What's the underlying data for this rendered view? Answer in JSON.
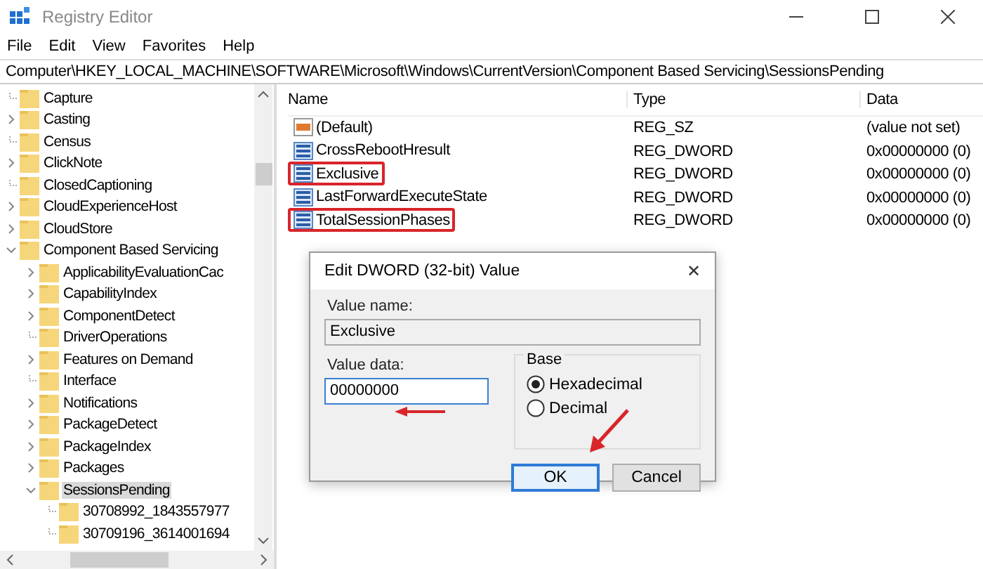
{
  "window": {
    "title": "Registry Editor"
  },
  "menu": [
    "File",
    "Edit",
    "View",
    "Favorites",
    "Help"
  ],
  "address": "Computer\\HKEY_LOCAL_MACHINE\\SOFTWARE\\Microsoft\\Windows\\CurrentVersion\\Component Based Servicing\\SessionsPending",
  "tree": [
    {
      "label": "Capture",
      "selected": false
    },
    {
      "label": "Casting",
      "expanded": false,
      "selected": false
    },
    {
      "label": "Census",
      "selected": false
    },
    {
      "label": "ClickNote",
      "expanded": false,
      "selected": false
    },
    {
      "label": "ClosedCaptioning",
      "selected": false
    },
    {
      "label": "CloudExperienceHost",
      "expanded": false,
      "selected": false
    },
    {
      "label": "CloudStore",
      "expanded": false,
      "selected": false
    },
    {
      "label": "Component Based Servicing",
      "expanded": true,
      "selected": false,
      "children": [
        {
          "label": "ApplicabilityEvaluationCac",
          "expanded": false,
          "selected": false
        },
        {
          "label": "CapabilityIndex",
          "expanded": false,
          "selected": false
        },
        {
          "label": "ComponentDetect",
          "expanded": false,
          "selected": false
        },
        {
          "label": "DriverOperations",
          "selected": false
        },
        {
          "label": "Features on Demand",
          "expanded": false,
          "selected": false
        },
        {
          "label": "Interface",
          "selected": false
        },
        {
          "label": "Notifications",
          "expanded": false,
          "selected": false
        },
        {
          "label": "PackageDetect",
          "expanded": false,
          "selected": false
        },
        {
          "label": "PackageIndex",
          "expanded": false,
          "selected": false
        },
        {
          "label": "Packages",
          "expanded": false,
          "selected": false
        },
        {
          "label": "SessionsPending",
          "expanded": true,
          "selected": true,
          "children": [
            {
              "label": "30708992_1843557977",
              "selected": false
            },
            {
              "label": "30709196_3614001694",
              "selected": false
            }
          ]
        }
      ]
    }
  ],
  "table": {
    "columns": [
      "Name",
      "Type",
      "Data"
    ],
    "rows": [
      {
        "kind": "string",
        "name": "(Default)",
        "type": "REG_SZ",
        "data": "(value not set)",
        "highlighted": false
      },
      {
        "kind": "dword",
        "name": "CrossRebootHresult",
        "type": "REG_DWORD",
        "data": "0x00000000 (0)",
        "highlighted": false
      },
      {
        "kind": "dword",
        "name": "Exclusive",
        "type": "REG_DWORD",
        "data": "0x00000000 (0)",
        "highlighted": true
      },
      {
        "kind": "dword",
        "name": "LastForwardExecuteState",
        "type": "REG_DWORD",
        "data": "0x00000000 (0)",
        "highlighted": false
      },
      {
        "kind": "dword",
        "name": "TotalSessionPhases",
        "type": "REG_DWORD",
        "data": "0x00000000 (0)",
        "highlighted": true
      }
    ]
  },
  "dialog": {
    "title": "Edit DWORD (32-bit) Value",
    "close": "✕",
    "value_name_label": "Value name:",
    "value_name": "Exclusive",
    "value_data_label": "Value data:",
    "value_data": "00000000",
    "base_label": "Base",
    "radios": [
      {
        "label": "Hexadecimal",
        "selected": true
      },
      {
        "label": "Decimal",
        "selected": false
      }
    ],
    "buttons": [
      {
        "label": "OK",
        "default": true
      },
      {
        "label": "Cancel",
        "default": false
      }
    ]
  }
}
